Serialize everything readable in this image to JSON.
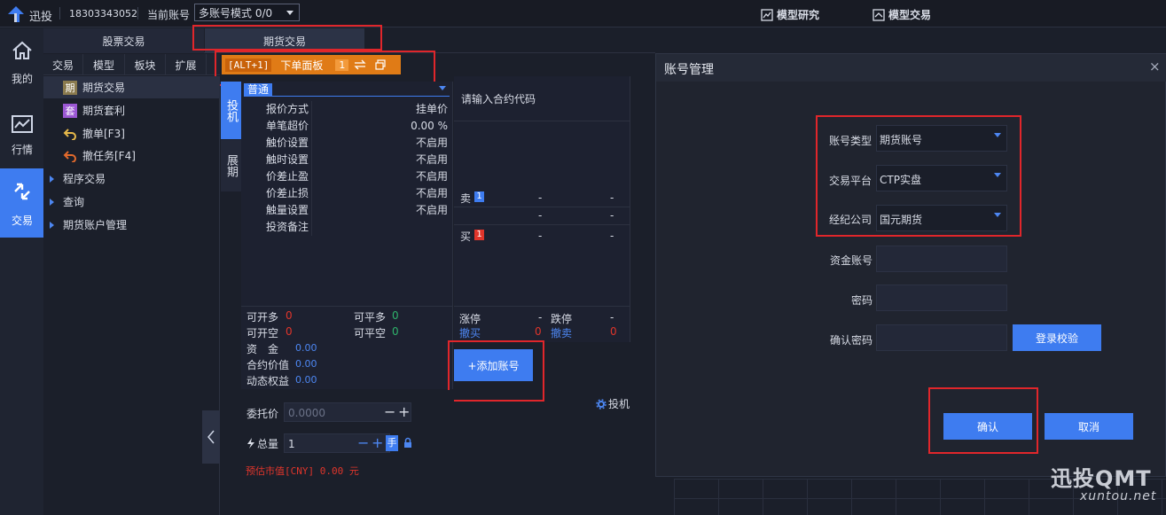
{
  "app": {
    "name": "迅投",
    "phone": "18303343052",
    "account_label": "当前账号",
    "account_mode": "多账号模式 0/0"
  },
  "top_nav": {
    "research": "模型研究",
    "trade": "模型交易"
  },
  "left_rail": [
    {
      "label": "我的"
    },
    {
      "label": "行情"
    },
    {
      "label": "交易"
    }
  ],
  "main_tabs": [
    "股票交易",
    "期货交易"
  ],
  "sub_tabs": [
    "交易",
    "模型",
    "板块",
    "扩展"
  ],
  "shortcut": {
    "key": "[ALT+1]",
    "label": "下单面板",
    "count": "1"
  },
  "tree": {
    "items": [
      "期货交易",
      "期货套利",
      "撤单[F3]",
      "撤任务[F4]"
    ],
    "item_badges": [
      "期",
      "套"
    ],
    "groups": [
      "程序交易",
      "查询",
      "期货账户管理"
    ]
  },
  "vtabs": [
    "投机",
    "展期"
  ],
  "order_form": {
    "mode": "普通",
    "rows": [
      {
        "k": "报价方式",
        "v": "挂单价"
      },
      {
        "k": "单笔超价",
        "v": "0.00 %"
      },
      {
        "k": "触价设置",
        "v": "不启用"
      },
      {
        "k": "触时设置",
        "v": "不启用"
      },
      {
        "k": "价差止盈",
        "v": "不启用"
      },
      {
        "k": "价差止损",
        "v": "不启用"
      },
      {
        "k": "触量设置",
        "v": "不启用"
      },
      {
        "k": "投资备注",
        "v": ""
      }
    ]
  },
  "quote": {
    "placeholder": "请输入合约代码",
    "sell": "卖",
    "buy": "买",
    "level": "1",
    "dash": "-",
    "limit_up": "涨停",
    "limit_down": "跌停",
    "cancel_buy": "撤买",
    "cancel_sell": "撤卖",
    "zero": "0"
  },
  "position": {
    "open_long": "可开多",
    "open_short": "可开空",
    "close_long": "可平多",
    "close_short": "可平空",
    "zero": "0",
    "funds": "资　金",
    "contract_value": "合约价值",
    "dynamic_equity": "动态权益",
    "amount": "0.00"
  },
  "add_account": "+添加账号",
  "speculate": "投机",
  "entrust": {
    "price_label": "委托价",
    "price_placeholder": "0.0000",
    "qty_label": "总量",
    "qty": "1",
    "unit": "手"
  },
  "estimate": "预估市值[CNY] 0.00 元",
  "dialog": {
    "title": "账号管理",
    "account_type_label": "账号类型",
    "account_type": "期货账号",
    "platform_label": "交易平台",
    "platform": "CTP实盘",
    "broker_label": "经纪公司",
    "broker": "国元期货",
    "fund_account_label": "资金账号",
    "password_label": "密码",
    "confirm_password_label": "确认密码",
    "verify_button": "登录校验",
    "ok_button": "确认",
    "cancel_button": "取消"
  },
  "watermark": {
    "brand": "迅投QMT",
    "url": "xuntou.net"
  },
  "colors": {
    "accent": "#3e7cf0",
    "highlight": "#e0262b",
    "orange": "#e07b16",
    "red": "#e0352b",
    "green": "#2fb36b"
  }
}
